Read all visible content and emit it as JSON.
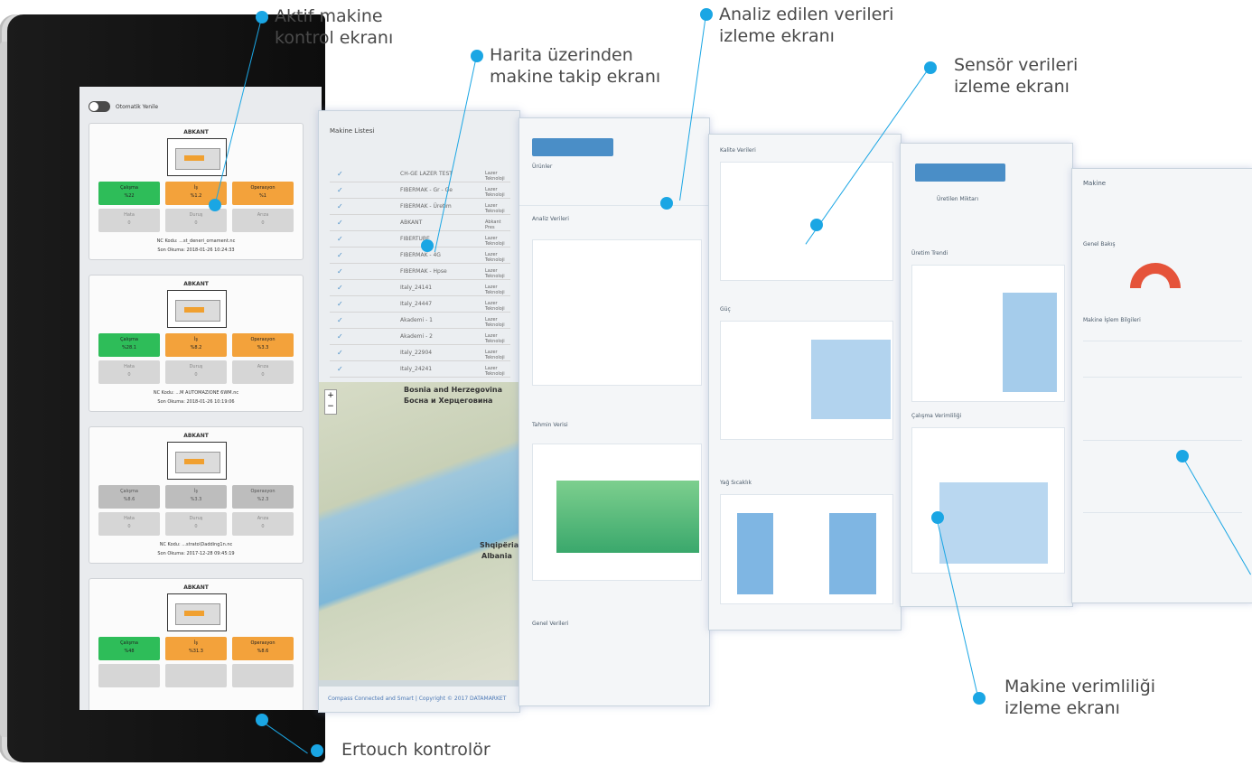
{
  "callouts": {
    "aktif": "Aktif makine\nkontrol ekranı",
    "harita": "Harita üzerinden\nmakine takip ekranı",
    "analiz": "Analiz edilen verileri\nizleme ekranı",
    "sensor": "Sensör verileri\nizleme ekranı",
    "verim": "Makine verimliliği\nizleme ekranı",
    "ertouch": "Ertouch kontrolör"
  },
  "tablet": {
    "toggle_label": "Otomatik Yenile",
    "cards": [
      {
        "title": "ABKANT",
        "t1": "Çalışma\n%22",
        "t2": "İş\n%1.2",
        "t3": "Operasyon\n%1",
        "b1": "Hata\n0",
        "b2": "Duruş\n0",
        "b3": "Arıza\n0",
        "foot1": "NC Kodu: ...st_deneri_ornament.nc",
        "foot2": "Son Okuma: 2018-01-26 10:24:33"
      },
      {
        "title": "ABKANT",
        "t1": "Çalışma\n%28.1",
        "t2": "İş\n%8.2",
        "t3": "Operasyon\n%3.3",
        "b1": "Hata\n0",
        "b2": "Duruş\n0",
        "b3": "Arıza\n0",
        "foot1": "NC Kodu: ...M AUTOMAZIONE 6WM.nc",
        "foot2": "Son Okuma: 2018-01-26 10:19:06"
      },
      {
        "title": "ABKANT",
        "t1": "Çalışma\n%8.6",
        "t2": "İş\n%3.3",
        "t3": "Operasyon\n%2.3",
        "b1": "Hata\n0",
        "b2": "Duruş\n0",
        "b3": "Arıza\n0",
        "foot1": "NC Kodu: ...strato\\Dadding1n.nc",
        "foot2": "Son Okuma: 2017-12-28 09:45:19"
      },
      {
        "title": "ABKANT",
        "t1": "Çalışma\n%48",
        "t2": "İş\n%31.3",
        "t3": "Operasyon\n%8.6",
        "b1": "",
        "b2": "",
        "b3": "",
        "foot1": "",
        "foot2": ""
      }
    ]
  },
  "map_panel": {
    "title": "Makine Listesi",
    "rows": [
      {
        "name": "CH-GE LAZER TEST",
        "type": "Lazer Teknoloji"
      },
      {
        "name": "FIBERMAK - Gr - Ge",
        "type": "Lazer Teknoloji"
      },
      {
        "name": "FIBERMAK - Üretim",
        "type": "Lazer Teknoloji"
      },
      {
        "name": "ABKANT",
        "type": "Abkant Pres"
      },
      {
        "name": "FIBERTUBE",
        "type": "Lazer Teknoloji"
      },
      {
        "name": "FIBERMAK - 4G",
        "type": "Lazer Teknoloji"
      },
      {
        "name": "FIBERMAK - Hpse",
        "type": "Lazer Teknoloji"
      },
      {
        "name": "Italy_24141",
        "type": "Lazer Teknoloji"
      },
      {
        "name": "Italy_24447",
        "type": "Lazer Teknoloji"
      },
      {
        "name": "Akademi - 1",
        "type": "Lazer Teknoloji"
      },
      {
        "name": "Akademi - 2",
        "type": "Lazer Teknoloji"
      },
      {
        "name": "Italy_22904",
        "type": "Lazer Teknoloji"
      },
      {
        "name": "Italy_24241",
        "type": "Lazer Teknoloji"
      }
    ],
    "map_labels": [
      "Bosnia and Herzegovina",
      "Босна и Херцеговина",
      "Shqipëria",
      "Albania"
    ],
    "footer": "Compass Connected and Smart | Copyright © 2017  DATAMARKET"
  },
  "panels": {
    "p3_tab": "Ürünler",
    "p3_sec1": "Analiz Verileri",
    "p3_sec2": "Tahmin Verisi",
    "p3_sec3": "Genel Verileri",
    "p4_sec1": "Kalite Verileri",
    "p4_sec2": "Güç",
    "p4_sec3": "Yağ Sıcaklık",
    "p5_tab": "Üretilen Miktarı",
    "p5_sec1": "Üretim Trendi",
    "p5_sec2": "Çalışma Verimliliği",
    "p6_title": "Makine",
    "p6_sec1": "Genel Bakış",
    "p6_sec2": "Makine İşlem Bilgileri"
  }
}
